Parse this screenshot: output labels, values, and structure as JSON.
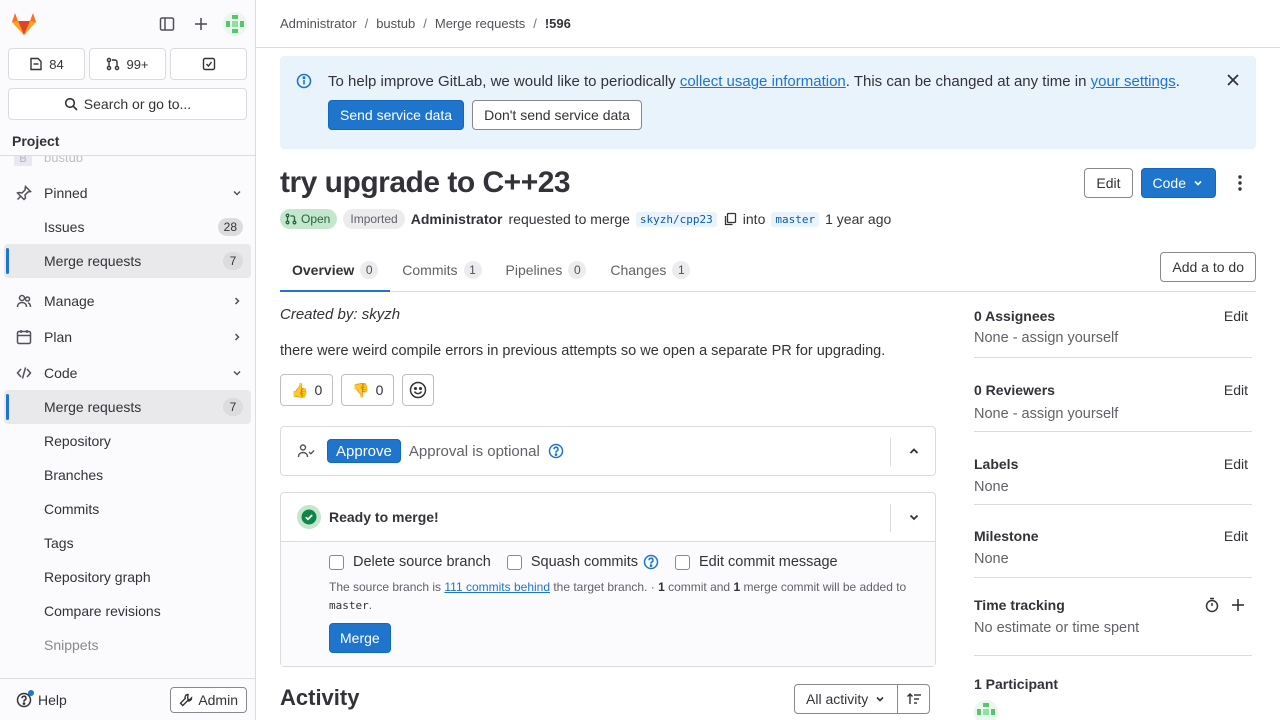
{
  "sidebar": {
    "counters": {
      "issues": "84",
      "merge_requests": "99+"
    },
    "search_label": "Search or go to...",
    "project_header": "Project",
    "cut_item_label": "bustub",
    "cut_item_badge": "B",
    "pinned": {
      "label": "Pinned",
      "items": [
        {
          "label": "Issues",
          "count": "28"
        },
        {
          "label": "Merge requests",
          "count": "7"
        }
      ]
    },
    "manage_label": "Manage",
    "plan_label": "Plan",
    "code": {
      "label": "Code",
      "items": [
        {
          "label": "Merge requests",
          "count": "7"
        },
        {
          "label": "Repository"
        },
        {
          "label": "Branches"
        },
        {
          "label": "Commits"
        },
        {
          "label": "Tags"
        },
        {
          "label": "Repository graph"
        },
        {
          "label": "Compare revisions"
        },
        {
          "label": "Snippets"
        }
      ]
    },
    "help_label": "Help",
    "admin_label": "Admin"
  },
  "breadcrumb": [
    "Administrator",
    "bustub",
    "Merge requests",
    "!596"
  ],
  "banner": {
    "text_before": "To help improve GitLab, we would like to periodically ",
    "link1": "collect usage information",
    "text_middle": ". This can be changed at any time in ",
    "link2": "your settings",
    "text_after": ".",
    "send_label": "Send service data",
    "dont_send_label": "Don't send service data"
  },
  "mr": {
    "title": "try upgrade to C++23",
    "edit_label": "Edit",
    "code_label": "Code",
    "status": "Open",
    "imported": "Imported",
    "author": "Administrator",
    "requested_text": "requested to merge",
    "source_branch": "skyzh/cpp23",
    "into_text": "into",
    "target_branch": "master",
    "time_ago": "1 year ago"
  },
  "tabs": [
    {
      "label": "Overview",
      "count": "0"
    },
    {
      "label": "Commits",
      "count": "1"
    },
    {
      "label": "Pipelines",
      "count": "0"
    },
    {
      "label": "Changes",
      "count": "1"
    }
  ],
  "add_todo_label": "Add a to do",
  "description": {
    "created_by": "Created by: skyzh",
    "body": "there were weird compile errors in previous attempts so we open a separate PR for upgrading."
  },
  "reactions": {
    "thumbs_up_emoji": "👍",
    "thumbs_up": "0",
    "thumbs_down_emoji": "👎",
    "thumbs_down": "0"
  },
  "approval": {
    "approve_label": "Approve",
    "optional_text": "Approval is optional"
  },
  "merge": {
    "status_title": "Ready to merge!",
    "delete_branch_label": "Delete source branch",
    "squash_label": "Squash commits",
    "edit_message_label": "Edit commit message",
    "note_prefix": "The source branch is ",
    "behind_link": "111 commits behind",
    "note_middle": " the target branch. · ",
    "commit_count": "1",
    "note_commit": " commit and ",
    "merge_commit_count": "1",
    "note_merge_commit": " merge commit will be added to ",
    "note_target": "master",
    "note_end": ".",
    "merge_label": "Merge"
  },
  "activity": {
    "title": "Activity",
    "filter_label": "All activity"
  },
  "right_sidebar": {
    "assignees": {
      "title": "0 Assignees",
      "value": "None - assign yourself",
      "edit": "Edit"
    },
    "reviewers": {
      "title": "0 Reviewers",
      "value": "None - assign yourself",
      "edit": "Edit"
    },
    "labels": {
      "title": "Labels",
      "value": "None",
      "edit": "Edit"
    },
    "milestone": {
      "title": "Milestone",
      "value": "None",
      "edit": "Edit"
    },
    "time_tracking": {
      "title": "Time tracking",
      "value": "No estimate or time spent"
    },
    "participants": {
      "title": "1 Participant"
    }
  },
  "colors": {
    "accent": "#1f75cb",
    "open_status_bg": "#c3e6cd",
    "open_status_text": "#24663b",
    "banner_bg": "#e9f3fc"
  }
}
